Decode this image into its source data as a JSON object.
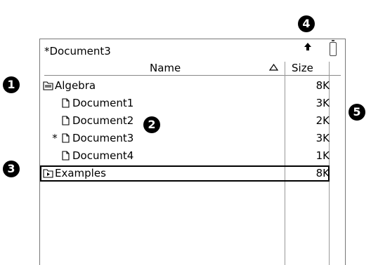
{
  "document_title": "*Document3",
  "columns": {
    "name": "Name",
    "size": "Size"
  },
  "rows": [
    {
      "marker": "",
      "kind": "folder-open",
      "label": "Algebra",
      "size": "8K"
    },
    {
      "marker": "",
      "kind": "document",
      "label": "Document1",
      "size": "3K"
    },
    {
      "marker": "",
      "kind": "document",
      "label": "Document2",
      "size": "2K"
    },
    {
      "marker": "*",
      "kind": "document",
      "label": "Document3",
      "size": "3K"
    },
    {
      "marker": "",
      "kind": "document",
      "label": "Document4",
      "size": "1K"
    },
    {
      "marker": "",
      "kind": "folder-closed",
      "label": "Examples",
      "size": "8K"
    }
  ],
  "callouts": [
    "1",
    "2",
    "3",
    "4",
    "5"
  ],
  "selected_row": "Examples"
}
